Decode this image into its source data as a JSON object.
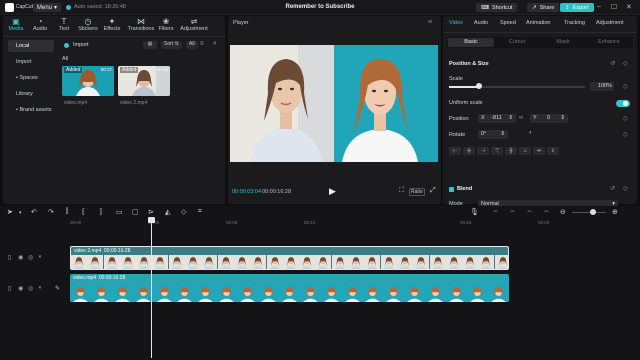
{
  "titlebar": {
    "app_name": "CapCut",
    "menu_label": "Menu",
    "autosave_text": "Auto saved: 18:26:48",
    "project_title": "Remember to Subscribe",
    "shortcut_label": "Shortcut",
    "share_label": "Share",
    "export_label": "Export"
  },
  "left_tabs": [
    {
      "label": "Media",
      "icon": "media-icon"
    },
    {
      "label": "Audio",
      "icon": "audio-icon"
    },
    {
      "label": "Text",
      "icon": "text-icon"
    },
    {
      "label": "Stickers",
      "icon": "stickers-icon"
    },
    {
      "label": "Effects",
      "icon": "effects-icon"
    },
    {
      "label": "Transitions",
      "icon": "transitions-icon"
    },
    {
      "label": "Filters",
      "icon": "filters-icon"
    },
    {
      "label": "Adjustment",
      "icon": "adjustment-icon"
    }
  ],
  "sub_nav": [
    "Local",
    "Import",
    "• Spaces",
    "Library",
    "• Brand assets"
  ],
  "library": {
    "import_label": "Import",
    "sort_label": "Sort",
    "all_filter": "All",
    "all_label": "All",
    "items": [
      {
        "badge": "Added",
        "duration": "00:17",
        "name": "video.mp4"
      },
      {
        "badge": "Added",
        "duration": "00:16",
        "name": "video 2.mp4"
      }
    ]
  },
  "player": {
    "label": "Player",
    "current_time": "00:00:03:04",
    "total_time": "00:00:16:28",
    "ratio_label": "Ratio"
  },
  "right_panel": {
    "tabs": [
      "Video",
      "Audio",
      "Speed",
      "Animation",
      "Tracking",
      "Adjustment"
    ],
    "subtabs": [
      "Basic",
      "Cutout",
      "Mask",
      "Enhance"
    ],
    "position_size_title": "Position & Size",
    "scale_label": "Scale",
    "scale_value": "100%",
    "scale_fraction": 0.22,
    "uniform_scale_label": "Uniform scale",
    "position_label": "Position",
    "position_x": "-811",
    "position_y": "0",
    "rotate_label": "Rotate",
    "rotate_value": "0°",
    "blend_title": "Blend",
    "mode_label": "Mode",
    "mode_value": "Normal",
    "opacity_label": "Opacity"
  },
  "timeline": {
    "ruler_ticks": [
      "00:00",
      "00:05",
      "00:10",
      "00:15",
      "00:20"
    ],
    "clips": [
      {
        "name": "video 2.mp4",
        "duration": "00:00:16:28"
      },
      {
        "name": "video.mp4",
        "duration": "00:00:16:28"
      }
    ],
    "cover_label": "Cover"
  },
  "colors": {
    "accent": "#33c5cc",
    "background": "#0f0f10",
    "panel": "#1b1b1e"
  }
}
